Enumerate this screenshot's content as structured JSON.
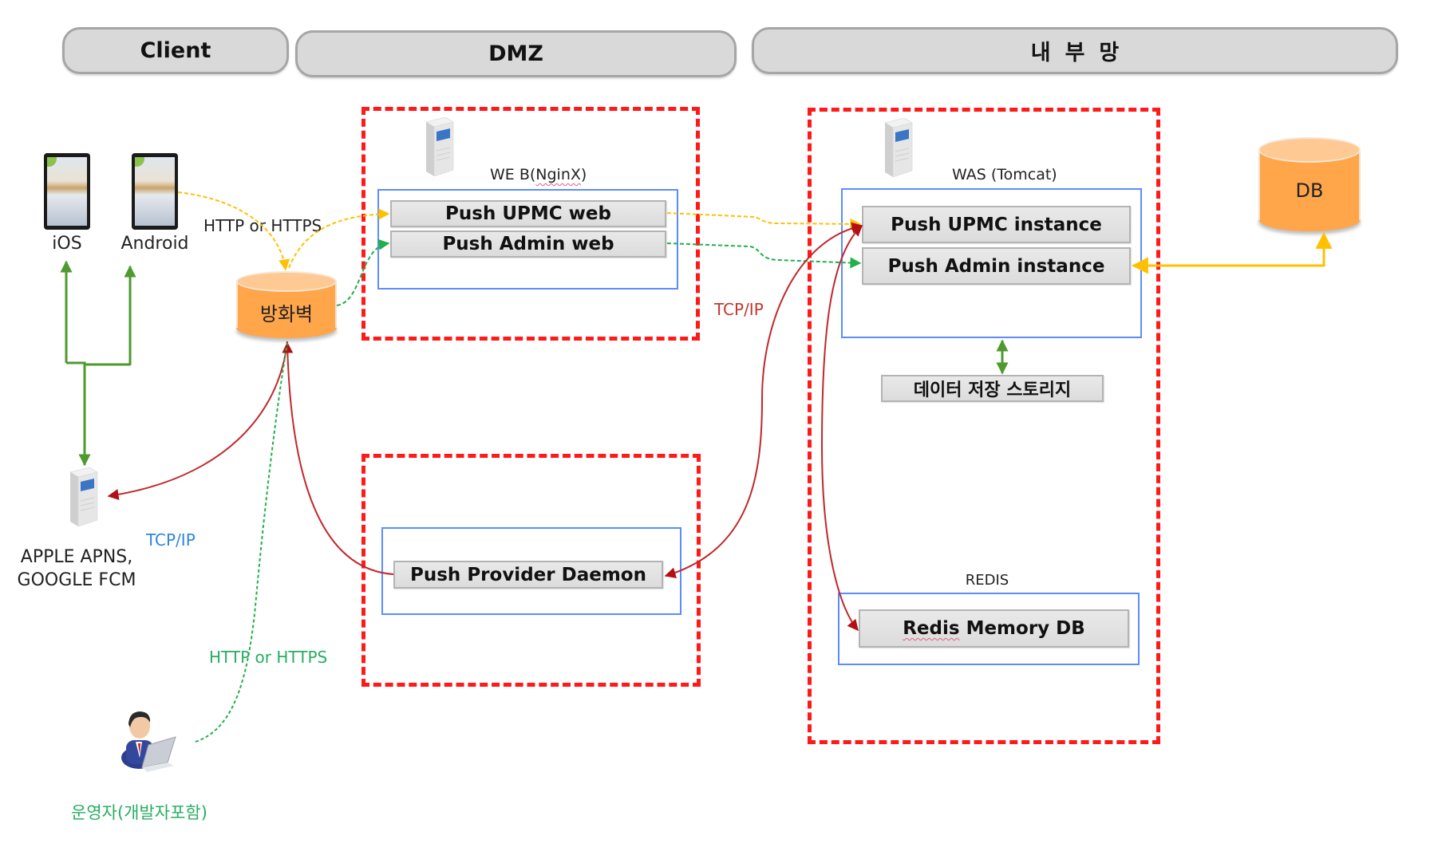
{
  "zones": {
    "client": "Client",
    "dmz": "DMZ",
    "internal": "내부망"
  },
  "client": {
    "ios_label": "iOS",
    "android_label": "Android",
    "push_service_label_line1": "APPLE APNS,",
    "push_service_label_line2": "GOOGLE FCM",
    "push_service_protocol": "TCP/IP",
    "operator_label": "운영자(개발자포함)",
    "operator_protocol": "HTTP or HTTPS",
    "device_protocol": "HTTP or HTTPS",
    "firewall_label": "방화벽"
  },
  "dmz": {
    "web_server_label_prefix": "WE B(",
    "web_server_label_name": "NginX",
    "web_server_label_suffix": ")",
    "components": [
      "Push UPMC web",
      "Push Admin web"
    ],
    "daemon": "Push Provider Daemon",
    "protocol_label": "TCP/IP"
  },
  "internal": {
    "was_label": "WAS (Tomcat)",
    "components": [
      "Push UPMC instance",
      "Push Admin instance"
    ],
    "storage": "데이터 저장 스토리지",
    "redis_label": "REDIS",
    "redis_component_word": "Redis",
    "redis_component_rest": " Memory DB",
    "db_label": "DB"
  },
  "colors": {
    "zone_border": "#ff1a1a",
    "container_border": "#5b8cff",
    "cylinder_fill": "#ffa54a",
    "https_user_flow": "#ffc000",
    "admin_flow": "#22b04b",
    "push_flow": "#c0282d",
    "device_link": "#4e9a2e",
    "db_link": "#ffc000"
  }
}
